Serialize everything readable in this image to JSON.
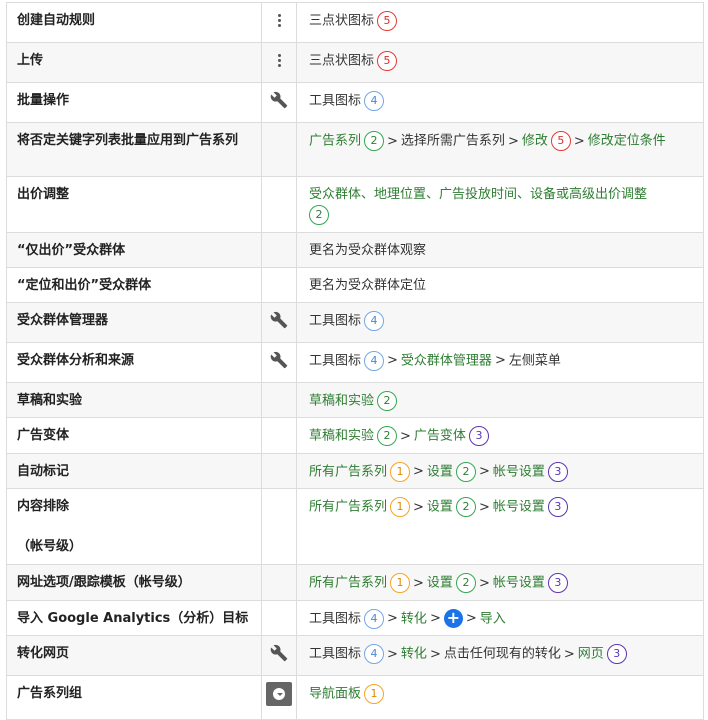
{
  "rows": [
    {
      "name": "创建自动规则",
      "icon": "three-dots-icon",
      "path": [
        {
          "t": "三点状图标",
          "c": "k"
        }
      ],
      "badge_after_first": "5",
      "bc": "n5"
    },
    {
      "name": "上传"
    },
    {
      "name": "批量操作"
    },
    {
      "name": "将否定关键字列表批量应用到广告系列"
    },
    {
      "name": "出价调整"
    },
    {
      "name": "“仅出价”受众群体"
    },
    {
      "name": "“定位和出价”受众群体"
    },
    {
      "name": "受众群体管理器"
    },
    {
      "name": "受众群体分析和来源"
    },
    {
      "name": "草稿和实验"
    },
    {
      "name": "广告变体"
    },
    {
      "name": "自动标记"
    },
    {
      "name": "内容排除",
      "name2": "（帐号级）"
    },
    {
      "name": "网址选项/跟踪模板（帐号级）"
    },
    {
      "name": "导入 Google Analytics（分析）目标"
    },
    {
      "name": "转化网页"
    },
    {
      "name": "广告系列组"
    }
  ],
  "labels": {
    "three_dots": "三点状图标",
    "tool_icon": "工具图标",
    "campaigns": "广告系列",
    "select_campaigns": "选择所需广告系列",
    "modify": "修改",
    "modify_targeting": "修改定位条件",
    "bid_adjust": "受众群体、地理位置、广告投放时间、设备或高级出价调整",
    "rename_observe": "更名为受众群体观察",
    "rename_target": "更名为受众群体定位",
    "audience_manager": "受众群体管理器",
    "left_menu": "左侧菜单",
    "drafts": "草稿和实验",
    "ad_variants": "广告变体",
    "all_campaigns": "所有广告系列",
    "settings": "设置",
    "account_settings": "帐号设置",
    "conversions": "转化",
    "import": "导入",
    "click_conversion": "点击任何现有的转化",
    "webpage": "网页",
    "nav_panel": "导航面板",
    "sep": ">",
    "plus": "+",
    "n1": "1",
    "n2": "2",
    "n3": "3",
    "n4": "4",
    "n5": "5"
  }
}
